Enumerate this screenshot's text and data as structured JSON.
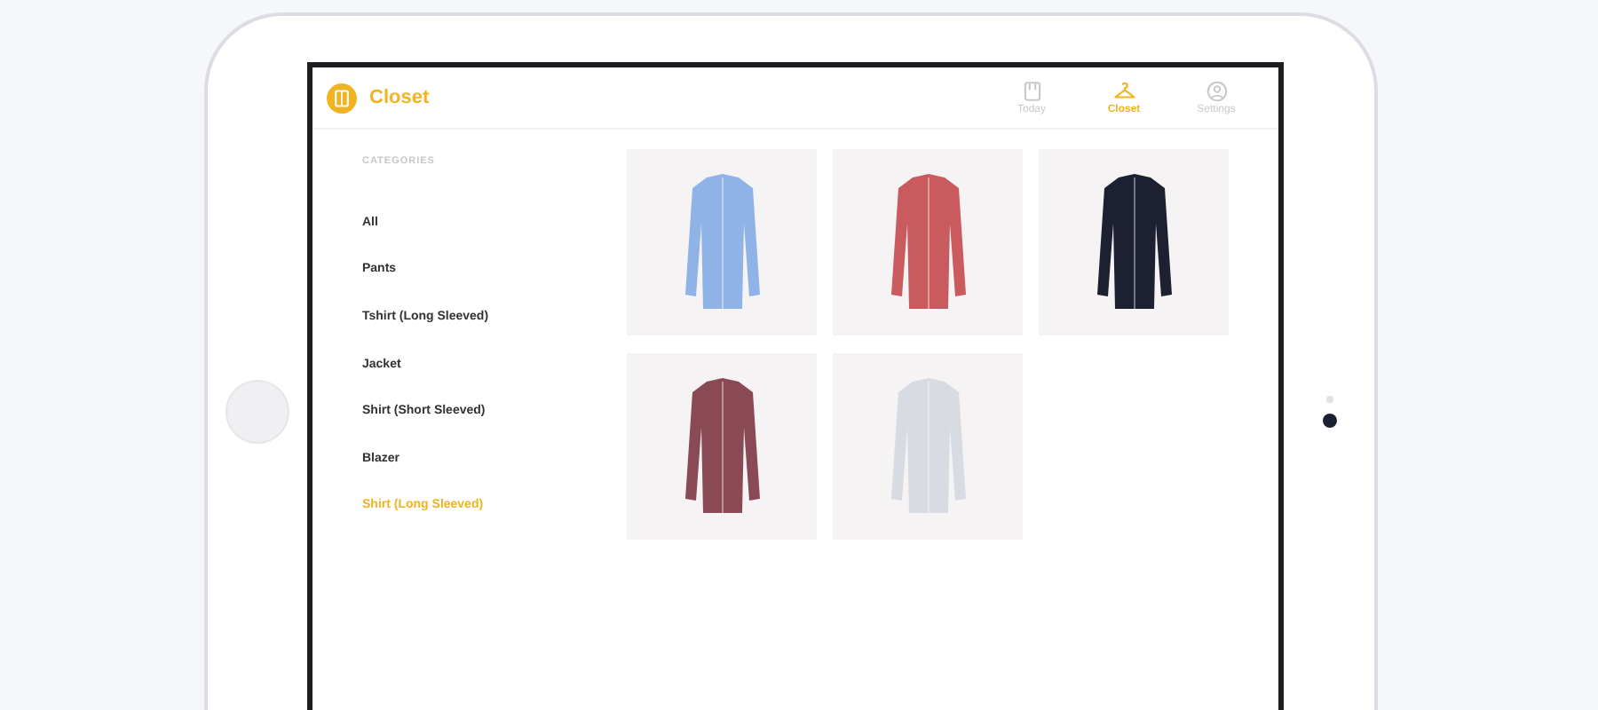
{
  "app": {
    "title": "Closet"
  },
  "tabs": [
    {
      "label": "Today",
      "kind": "calendar",
      "selected": false
    },
    {
      "label": "Closet",
      "kind": "hanger",
      "selected": true
    },
    {
      "label": "Settings",
      "kind": "person",
      "selected": false
    }
  ],
  "sidebar": {
    "heading": "CATEGORIES",
    "items": [
      {
        "label": "All",
        "selected": false
      },
      {
        "label": "Pants",
        "selected": false
      },
      {
        "label": "Tshirt (Long Sleeved)",
        "selected": false
      },
      {
        "label": "Jacket",
        "selected": false
      },
      {
        "label": "Shirt (Short Sleeved)",
        "selected": false
      },
      {
        "label": "Blazer",
        "selected": false
      },
      {
        "label": "Shirt (Long Sleeved)",
        "selected": true
      }
    ]
  },
  "products": [
    {
      "color": "#8fb3e6"
    },
    {
      "color": "#c95b5e"
    },
    {
      "color": "#1d2030"
    },
    {
      "color": "#8a4a55"
    },
    {
      "color": "#d9dbe3"
    }
  ]
}
